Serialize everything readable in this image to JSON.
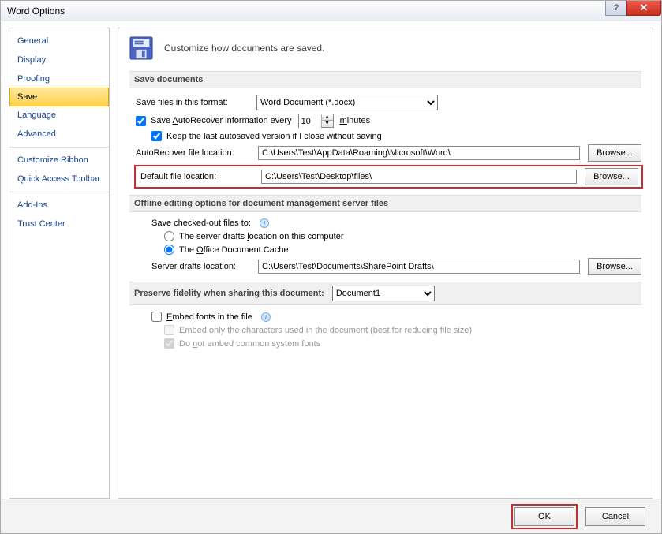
{
  "window": {
    "title": "Word Options"
  },
  "sidebar": {
    "items": [
      {
        "label": "General"
      },
      {
        "label": "Display"
      },
      {
        "label": "Proofing"
      },
      {
        "label": "Save",
        "selected": true
      },
      {
        "label": "Language"
      },
      {
        "label": "Advanced"
      },
      {
        "sep": true
      },
      {
        "label": "Customize Ribbon"
      },
      {
        "label": "Quick Access Toolbar"
      },
      {
        "sep": true
      },
      {
        "label": "Add-Ins"
      },
      {
        "label": "Trust Center"
      }
    ]
  },
  "header": {
    "text": "Customize how documents are saved."
  },
  "save_docs": {
    "section": "Save documents",
    "format_label": "Save files in this format:",
    "format_value": "Word Document (*.docx)",
    "autorecover_label_prefix": "Save ",
    "autorecover_label_u": "A",
    "autorecover_label_suffix": "utoRecover information every",
    "autorecover_minutes": "10",
    "minutes_label": "minutes",
    "minutes_u": "m",
    "keep_last_label": "Keep the last autosaved version if I close without saving",
    "ar_loc_label": "AutoRecover file location:",
    "ar_loc_value": "C:\\Users\\Test\\AppData\\Roaming\\Microsoft\\Word\\",
    "browse_label": "Browse...",
    "def_loc_label": "Default file location:",
    "def_loc_value": "C:\\Users\\Test\\Desktop\\files\\"
  },
  "offline": {
    "section": "Offline editing options for document management server files",
    "checked_out_label": "Save checked-out files to:",
    "radio1_prefix": "The server drafts ",
    "radio1_u": "l",
    "radio1_suffix": "ocation on this computer",
    "radio2_prefix": "The ",
    "radio2_u": "O",
    "radio2_suffix": "ffice Document Cache",
    "server_drafts_label": "Server drafts location:",
    "server_drafts_value": "C:\\Users\\Test\\Documents\\SharePoint Drafts\\",
    "browse_label": "Browse..."
  },
  "fidelity": {
    "section": "Preserve fidelity when sharing this document:",
    "doc_value": "Document1",
    "embed_u": "E",
    "embed_label": "mbed fonts in the file",
    "only_chars_prefix": "Embed only the ",
    "only_chars_u": "c",
    "only_chars_suffix": "haracters used in the document (best for reducing file size)",
    "no_common_prefix": "Do ",
    "no_common_u": "n",
    "no_common_suffix": "ot embed common system fonts"
  },
  "footer": {
    "ok": "OK",
    "cancel": "Cancel"
  }
}
